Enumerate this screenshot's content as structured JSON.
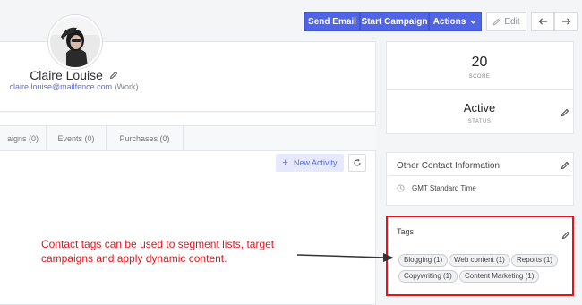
{
  "toolbar": {
    "send_email": "Send Email",
    "start_campaign": "Start Campaign",
    "actions": "Actions",
    "edit": "Edit"
  },
  "contact": {
    "name": "Claire Louise",
    "email": "claire.louise@mailfence.com",
    "email_type": "(Work)"
  },
  "tabs": [
    {
      "label": "aigns (0)"
    },
    {
      "label": "Events (0)"
    },
    {
      "label": "Purchases (0)"
    }
  ],
  "activity": {
    "new_label": "New Activity"
  },
  "score": {
    "value": "20",
    "label": "SCORE"
  },
  "status": {
    "value": "Active",
    "label": "STATUS"
  },
  "other_info": {
    "title": "Other Contact Information",
    "timezone": "GMT Standard Time"
  },
  "tags": {
    "title": "Tags",
    "items": [
      "Blogging (1)",
      "Web content (1)",
      "Reports (1)",
      "Copywriting (1)",
      "Content Marketing (1)"
    ]
  },
  "annotation": {
    "text": "Contact tags can be used to segment lists, target campaigns and apply dynamic content.",
    "color": "#e8121a"
  },
  "colors": {
    "primary": "#5065e5",
    "background": "#f4f5f7",
    "link": "#5b6fd8"
  }
}
